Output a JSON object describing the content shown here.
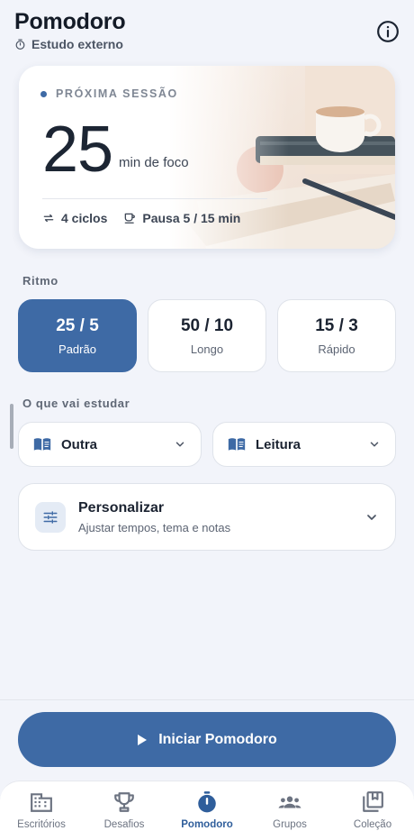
{
  "header": {
    "title": "Pomodoro",
    "subtitle": "Estudo externo",
    "subtitle_icon": "timer-icon",
    "info_icon": "info-icon"
  },
  "session_card": {
    "label": "PRÓXIMA SESSÃO",
    "minutes": "25",
    "unit": "min de foco",
    "cycles": "4 ciclos",
    "pause": "Pausa 5 / 15 min",
    "cycles_icon": "repeat-icon",
    "pause_icon": "coffee-icon"
  },
  "rhythm": {
    "label": "Ritmo",
    "options": [
      {
        "value": "25 / 5",
        "label": "Padrão",
        "active": true
      },
      {
        "value": "50 / 10",
        "label": "Longo",
        "active": false
      },
      {
        "value": "15 / 3",
        "label": "Rápido",
        "active": false
      }
    ]
  },
  "study": {
    "label": "O que vai estudar",
    "subject": "Outra",
    "activity": "Leitura"
  },
  "customize": {
    "title": "Personalizar",
    "subtitle": "Ajustar tempos, tema e notas"
  },
  "start_button": {
    "label": "Iniciar Pomodoro"
  },
  "nav": {
    "items": [
      {
        "label": "Escritórios",
        "icon": "building-icon",
        "active": false
      },
      {
        "label": "Desafios",
        "icon": "trophy-icon",
        "active": false
      },
      {
        "label": "Pomodoro",
        "icon": "stopwatch-icon",
        "active": true
      },
      {
        "label": "Grupos",
        "icon": "groups-icon",
        "active": false
      },
      {
        "label": "Coleção",
        "icon": "collection-icon",
        "active": false
      }
    ]
  },
  "colors": {
    "accent": "#3e6aa5",
    "background": "#f2f4fa",
    "card": "#ffffff",
    "text": "#1b2331"
  }
}
